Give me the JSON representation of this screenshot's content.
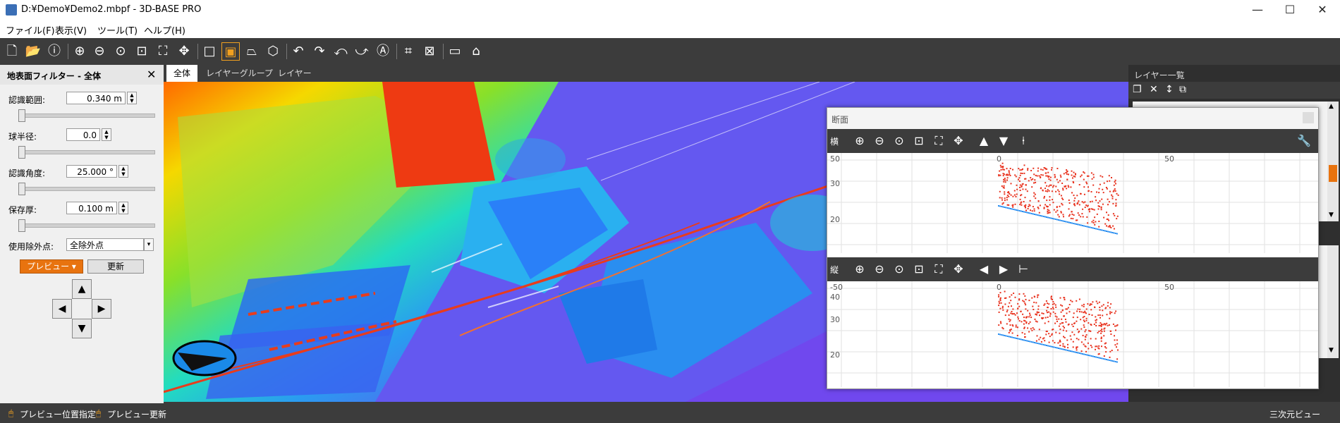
{
  "window": {
    "title": "D:¥Demo¥Demo2.mbpf - 3D-BASE PRO",
    "minimize": "—",
    "maximize": "☐",
    "close": "✕"
  },
  "menu": [
    {
      "label": "ファイル(F)"
    },
    {
      "label": "表示(V)"
    },
    {
      "label": "ツール(T)"
    },
    {
      "label": "ヘルプ(H)"
    }
  ],
  "toolbar_icons": [
    "new-file-icon",
    "open-folder-icon",
    "info-icon",
    "zoom-in-icon",
    "zoom-out-icon",
    "zoom-fit-icon",
    "zoom-area-icon",
    "fit-all-icon",
    "pan-icon",
    "box-icon",
    "box-select-icon",
    "slice-icon",
    "cube-icon",
    "undo-icon",
    "redo-icon",
    "rotate-left-icon",
    "rotate-right-icon",
    "auto-icon",
    "crop-icon",
    "clip-icon",
    "measure-icon",
    "house-icon"
  ],
  "filter_panel": {
    "title": "地表面フィルター - 全体",
    "close": "✕",
    "fields": [
      {
        "label": "認識範囲:",
        "value": "0.340 m",
        "slider": 0.0
      },
      {
        "label": "球半径:",
        "value": "0.0",
        "slider": 0.0
      },
      {
        "label": "認識角度:",
        "value": "25.000 °",
        "slider": 0.0
      },
      {
        "label": "保存厚:",
        "value": "0.100 m",
        "slider": 0.0
      }
    ],
    "outlier_label": "使用除外点:",
    "outlier_value": "全除外点",
    "preview_button": "プレビュー",
    "update_button": "更新",
    "arrows": {
      "up": "▲",
      "left": "◀",
      "right": "▶",
      "down": "▼"
    }
  },
  "view_tabs": [
    {
      "label": "全体",
      "active": true
    },
    {
      "label": "レイヤーグループ",
      "active": false
    },
    {
      "label": "レイヤー",
      "active": false
    }
  ],
  "layer_panel": {
    "title": "レイヤー一覧"
  },
  "section_window": {
    "title": "断面",
    "top_label": "横",
    "bottom_label": "縦",
    "top_axis": {
      "x_ticks": [
        "50",
        "0",
        "50"
      ],
      "y_ticks": [
        "30",
        "20"
      ]
    },
    "bottom_axis": {
      "x_ticks": [
        "-50",
        "0",
        "50"
      ],
      "y_ticks": [
        "40",
        "30",
        "20"
      ]
    }
  },
  "status": {
    "preview_position": "プレビュー位置指定",
    "preview_update": "プレビュー更新",
    "view_mode": "三次元ビュー"
  },
  "colors": {
    "accent": "#e8730f",
    "toolbar": "#3c3c3c",
    "point_red": "#e8321e",
    "point_blue": "#2a8ef0"
  }
}
